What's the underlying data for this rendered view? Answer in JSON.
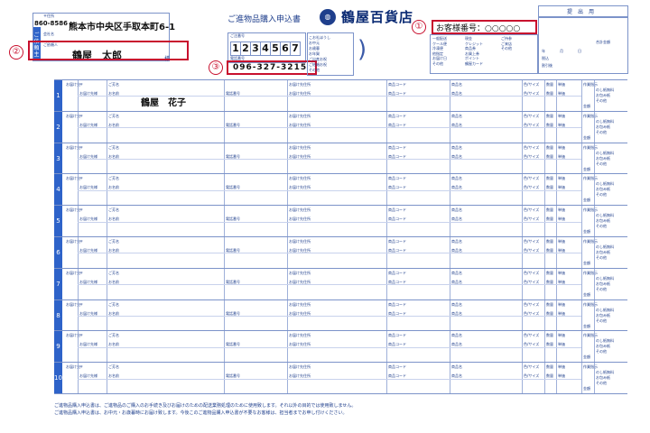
{
  "header": {
    "postal_label": "〒住所",
    "postal_code": "860-8586",
    "address": "熊本市中央区手取本町6-1",
    "company_label": "会社名",
    "name_label": "ご依頼人",
    "sender_name": "鶴屋　太郎",
    "sama": "様",
    "side_label": "ご依頼主",
    "customer_no_label": "ご注番号",
    "customer_no_digits": [
      "1",
      "2",
      "3",
      "4",
      "5",
      "6",
      "7"
    ],
    "phone_label": "電話番号",
    "phone": "096-327-3215",
    "form_title": "ご進物品購入申込書",
    "brand": "鶴屋百貨店",
    "customer_number": "お客様番号：○○○○○",
    "submit_label": "提　出　用",
    "checks_col1": [
      "こお礼ほうし",
      "お中元",
      "お歳暮",
      "お年賀",
      "ご出産お祝",
      "ご結婚お祝",
      "その他"
    ],
    "checks_col2": [
      "一般配送",
      "クール便",
      "冷凍便",
      "他指定",
      "お届け日",
      "その他"
    ],
    "payment_header": "代　金　支　払",
    "payment_opts": [
      "現金",
      "クレジット",
      "商品券",
      "お買上券",
      "ポイント",
      "鶴屋カード",
      "その他"
    ],
    "pay_extra": [
      "ご持参",
      "ご来店"
    ],
    "date_labels": [
      "年",
      "月",
      "日"
    ],
    "tax_label": "税込",
    "tax_label2": "割引後",
    "total_label": "合計金額"
  },
  "annotations": [
    "①",
    "②",
    "③"
  ],
  "rows_header": {
    "dest": "お届け先",
    "zip": "〒",
    "name": "ご芳名",
    "name2": "お名前",
    "address": "お届け先住所",
    "phone": "電話番号",
    "relation": "お届け先様",
    "product_code": "商品コード",
    "product_name": "商品名",
    "color_size": "色/サイズ",
    "qty": "数量",
    "price": "単価",
    "note": "作業指示",
    "noshi": [
      "のし紙無料",
      "お包み紙",
      "その他"
    ],
    "amount": "金額"
  },
  "recipient_first": "鶴屋　花子",
  "row_numbers": [
    "1",
    "2",
    "3",
    "4",
    "5",
    "6",
    "7",
    "8",
    "9",
    "10"
  ],
  "footer": {
    "line1": "ご進物品購入申込書は、ご進物品のご購入のお手続き及びお届けのための配送業務処理のために使用致します。それ以外の目的では使用致しません。",
    "line2": "ご進物品購入申込書は、お中元・お歳暮時にお届け致します。今後このご進物品購入申込書が不要なお客様は、担当者までお申し付けください。"
  }
}
